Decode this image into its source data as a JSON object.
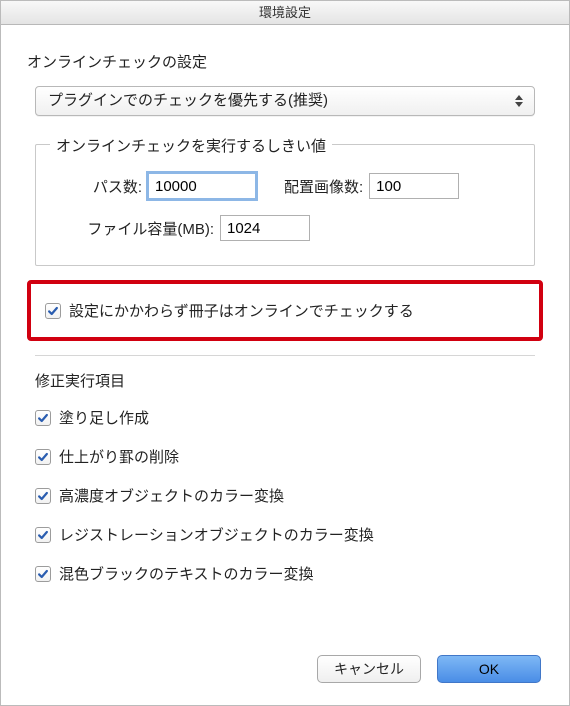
{
  "window": {
    "title": "環境設定"
  },
  "online_check": {
    "section_label": "オンラインチェックの設定",
    "select_value": "プラグインでのチェックを優先する(推奨)"
  },
  "threshold": {
    "legend": "オンラインチェックを実行するしきい値",
    "path_label": "パス数:",
    "path_value": "10000",
    "images_label": "配置画像数:",
    "images_value": "100",
    "filesize_label": "ファイル容量(MB):",
    "filesize_value": "1024"
  },
  "highlight": {
    "always_online_label": "設定にかかわらず冊子はオンラインでチェックする"
  },
  "fixes": {
    "section_label": "修正実行項目",
    "items": [
      "塗り足し作成",
      "仕上がり罫の削除",
      "高濃度オブジェクトのカラー変換",
      "レジストレーションオブジェクトのカラー変換",
      "混色ブラックのテキストのカラー変換"
    ]
  },
  "buttons": {
    "cancel": "キャンセル",
    "ok": "OK"
  }
}
